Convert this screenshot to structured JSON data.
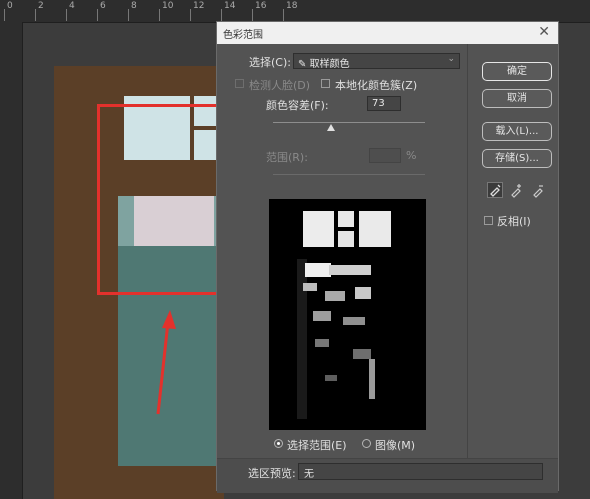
{
  "dialog": {
    "title": "色彩范围",
    "select_label": "选择(C):",
    "select_value": "取样颜色",
    "detect_faces_label": "检测人脸(D)",
    "localized_label": "本地化颜色簇(Z)",
    "fuzziness_label": "颜色容差(F):",
    "fuzziness_value": "73",
    "fuzziness_fraction": 0.38,
    "range_label": "范围(R):",
    "range_unit": "%",
    "radio_selection": "选择范围(E)",
    "radio_image": "图像(M)",
    "preview_label": "选区预览:",
    "preview_value": "无",
    "invert_label": "反相(I)",
    "buttons": {
      "ok": "确定",
      "cancel": "取消",
      "load": "载入(L)...",
      "save": "存储(S)..."
    }
  },
  "ruler": {
    "numbers": [
      "0",
      "2",
      "4",
      "6",
      "8",
      "10",
      "12",
      "14",
      "16",
      "18"
    ]
  },
  "colors": {
    "annotation_red": "#e3312c",
    "dialog_bg": "#535353",
    "titlebar_bg": "#f0f0f0"
  },
  "icons": [
    "eyedropper-icon",
    "eyedropper-plus-icon",
    "eyedropper-minus-icon",
    "close-icon",
    "chevron-down-icon"
  ]
}
